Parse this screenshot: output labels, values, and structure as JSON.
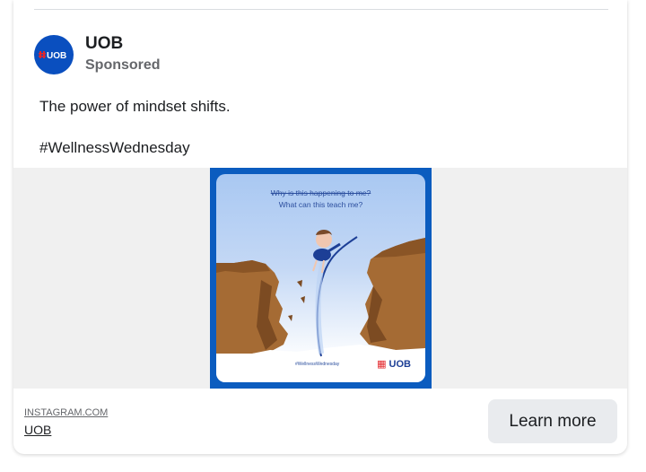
{
  "post": {
    "page_name": "UOB",
    "sponsored_label": "Sponsored",
    "avatar_text": "UOB",
    "text_line1": "The power of mindset shifts.",
    "text_line2": "#WellnessWednesday"
  },
  "ad_image": {
    "crossed_text": "Why is this happening to me?",
    "question_text": "What can this teach me?",
    "hashtag": "#WellnessWednesday",
    "logo_text": "UOB"
  },
  "link": {
    "domain": "INSTAGRAM.COM",
    "title": "UOB",
    "cta_label": "Learn more"
  },
  "colors": {
    "brand_blue": "#0a4fbf",
    "brand_red": "#e3262b",
    "cta_background": "#e9ebee"
  }
}
